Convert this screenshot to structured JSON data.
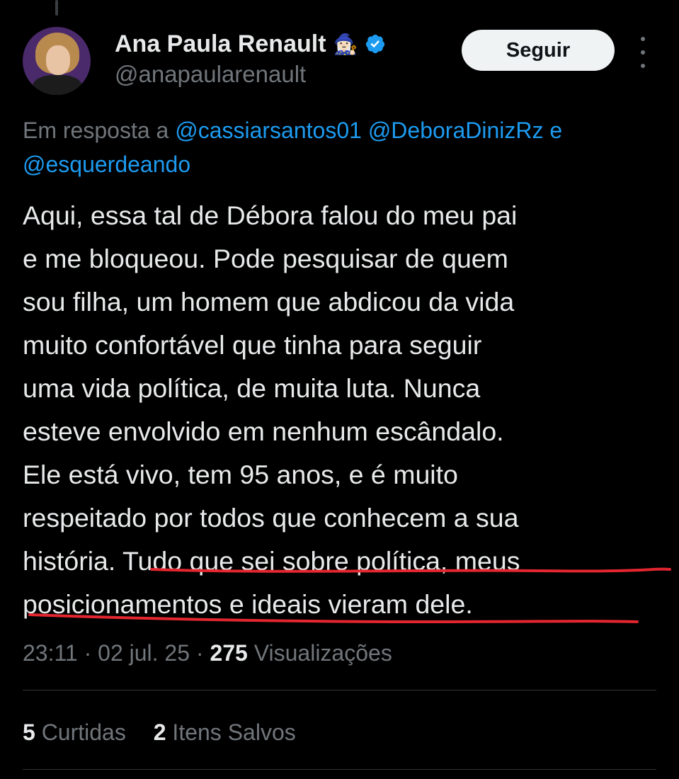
{
  "author": {
    "display_name": "Ana Paula Renault",
    "emoji": "🧙🏻‍♀️",
    "handle": "@anapaularenault"
  },
  "follow_label": "Seguir",
  "reply_context": {
    "prefix": "Em resposta a",
    "mentions": [
      "@cassiarsantos01",
      "@DeboraDinizRz",
      "@esquerdeando"
    ],
    "conjunction": "e"
  },
  "tweet_lines": [
    "Aqui, essa tal de Débora falou do meu pai",
    "e me bloqueou. Pode pesquisar de quem",
    "sou filha, um homem que abdicou da vida",
    "muito confortável que tinha para seguir",
    "uma vida política, de muita luta. Nunca",
    "esteve envolvido em nenhum escândalo.",
    "Ele está vivo, tem 95 anos, e é muito",
    "respeitado por todos que conhecem a sua",
    "história. Tudo que sei sobre política, meus",
    "posicionamentos e ideais vieram dele."
  ],
  "meta": {
    "time": "23:11",
    "date": "02 jul. 25",
    "views_count": "275",
    "views_label": "Visualizações"
  },
  "stats": {
    "likes_count": "5",
    "likes_label": "Curtidas",
    "saves_count": "2",
    "saves_label": "Itens Salvos"
  },
  "colors": {
    "background": "#000000",
    "text": "#e7e9ea",
    "muted": "#71767b",
    "link": "#1d9bf0",
    "annotation": "#e3262f"
  }
}
